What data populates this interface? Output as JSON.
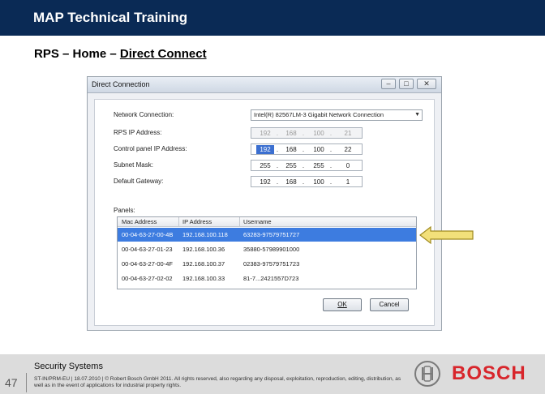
{
  "header": {
    "title": "MAP Technical Training"
  },
  "breadcrumb": {
    "prefix": "RPS – Home – ",
    "link": "Direct Connect"
  },
  "dialog": {
    "title": "Direct Connection",
    "fields": {
      "network_connection_label": "Network Connection:",
      "network_connection_value": "Intel(R) 82567LM-3 Gigabit Network Connection",
      "rps_ip_label": "RPS IP Address:",
      "rps_ip": [
        "192",
        "168",
        "100",
        "21"
      ],
      "control_panel_ip_label": "Control panel IP Address:",
      "control_panel_ip": [
        "192",
        "168",
        "100",
        "22"
      ],
      "subnet_mask_label": "Subnet Mask:",
      "subnet_mask": [
        "255",
        "255",
        "255",
        "0"
      ],
      "default_gateway_label": "Default Gateway:",
      "default_gateway": [
        "192",
        "168",
        "100",
        "1"
      ]
    },
    "panels_label": "Panels:",
    "table": {
      "headers": [
        "Mac Address",
        "IP Address",
        "Username"
      ],
      "rows": [
        [
          "00-04-63-27-00-4B",
          "192.168.100.118",
          "63283-97579751727"
        ],
        [
          "00-04-63-27-01-23",
          "192.168.100.36",
          "35880-57989901000"
        ],
        [
          "00-04-63-27-00-4F",
          "192.168.100.37",
          "02383-97579751723"
        ],
        [
          "00-04-63-27-02-02",
          "192.168.100.33",
          "81-7...2421557D723"
        ]
      ],
      "selected_row": 0
    },
    "ok_label": "OK",
    "cancel_label": "Cancel"
  },
  "footer": {
    "brand": "Security Systems",
    "legal": "ST-IN/PRM-EU | 18.07.2010 | © Robert Bosch GmbH 2011. All rights reserved, also regarding any disposal, exploitation, reproduction, editing, distribution, as well as in the event of applications for industrial property rights.",
    "page_number": "47",
    "logo_text": "BOSCH"
  },
  "colors": {
    "header": "#0a2a55",
    "selection": "#3d7ce0",
    "arrow_fill": "#f2e07a",
    "arrow_stroke": "#a08a20",
    "logo": "#d8262c"
  },
  "icons": [
    "minimize-icon",
    "maximize-icon",
    "close-icon",
    "dropdown-arrow-icon",
    "callout-arrow-icon",
    "bosch-armature-icon"
  ]
}
